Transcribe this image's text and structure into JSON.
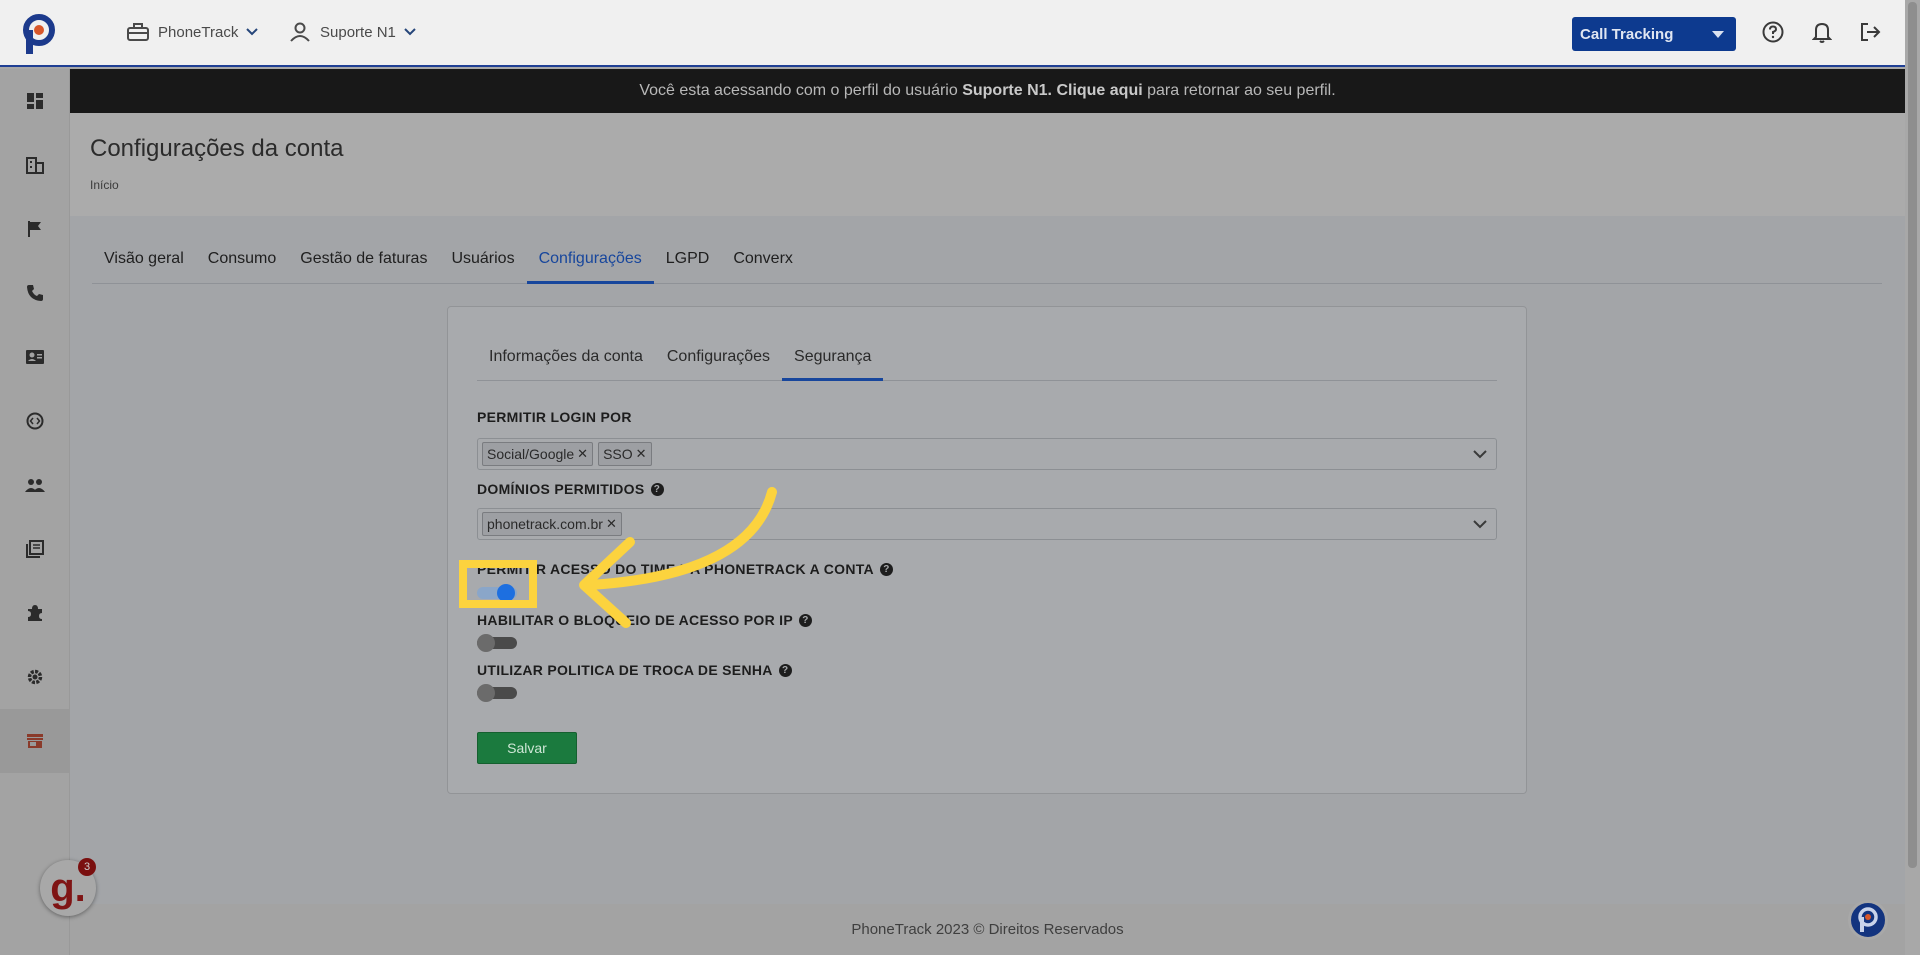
{
  "header": {
    "account_menu": "PhoneTrack",
    "user_menu": "Suporte N1",
    "product_selector": "Call Tracking"
  },
  "banner": {
    "text_before": "Você esta acessando com o perfil do usuário",
    "user_bold": "Suporte N1. Clique aqui",
    "text_after": "para retornar ao seu perfil."
  },
  "page": {
    "title": "Configurações da conta",
    "breadcrumb": "Início"
  },
  "tabs": [
    {
      "label": "Visão geral"
    },
    {
      "label": "Consumo"
    },
    {
      "label": "Gestão de faturas"
    },
    {
      "label": "Usuários"
    },
    {
      "label": "Configurações"
    },
    {
      "label": "LGPD"
    },
    {
      "label": "Converx"
    }
  ],
  "subtabs": [
    {
      "label": "Informações da conta"
    },
    {
      "label": "Configurações"
    },
    {
      "label": "Segurança"
    }
  ],
  "security": {
    "login_label": "PERMITIR LOGIN POR",
    "login_options": [
      "Social/Google",
      "SSO"
    ],
    "domains_label": "DOMÍNIOS PERMITIDOS",
    "domains": [
      "phonetrack.com.br"
    ],
    "team_access_label": "PERMITIR ACESSO DO TIME DA PHONETRACK A CONTA",
    "team_access_on": true,
    "ip_block_label": "HABILITAR O BLOQUEIO DE ACESSO POR IP",
    "ip_block_on": false,
    "password_policy_label": "UTILIZAR POLITICA DE TROCA DE SENHA",
    "password_policy_on": false,
    "save_label": "Salvar"
  },
  "footer": {
    "text": "PhoneTrack 2023 © Direitos Reservados"
  },
  "widgets": {
    "notification_badge": "3"
  },
  "colors": {
    "brand": "#0d3a8f",
    "accent_highlight": "#fcd33e",
    "save_button": "#1b7a3e",
    "toggle_on": "#1d6fe0"
  }
}
